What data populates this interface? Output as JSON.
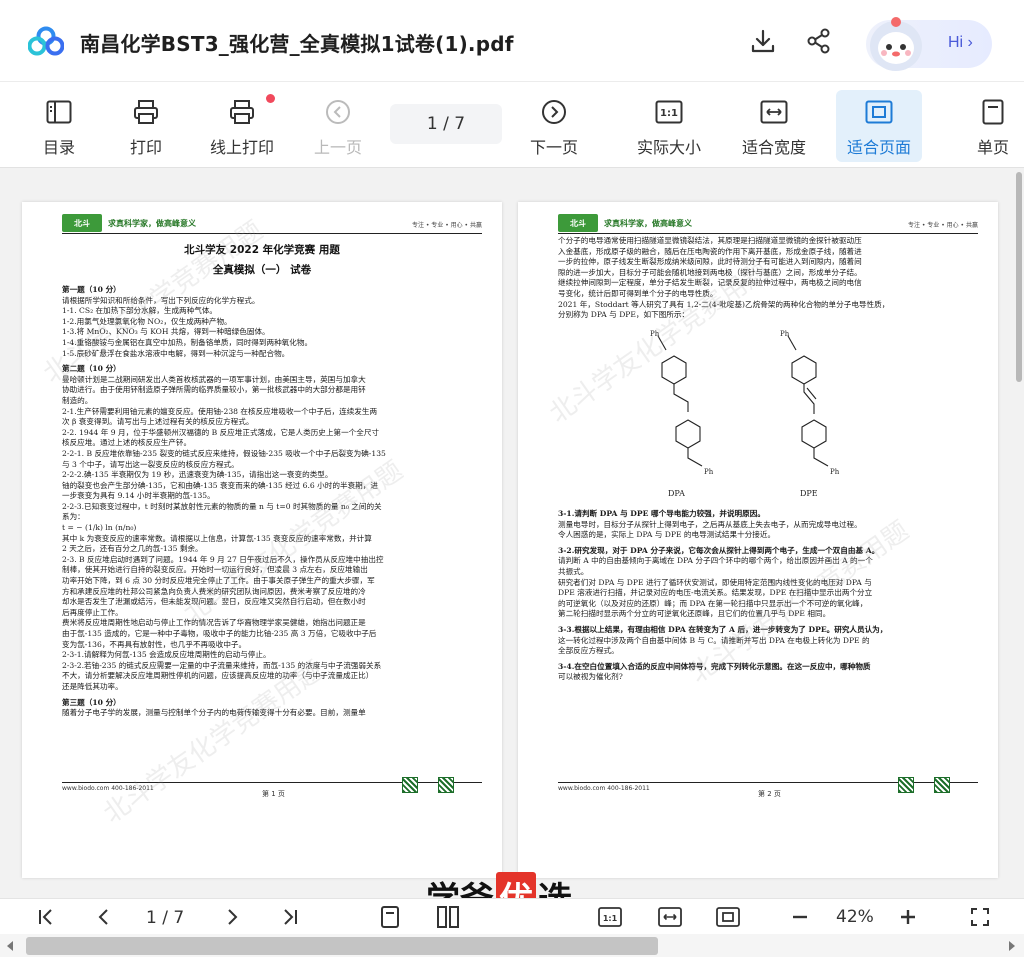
{
  "window": {
    "title": "南昌化学BST3_强化营_全真模拟1试卷(1).pdf",
    "hi_label": "Hi"
  },
  "toolbar": {
    "toc": "目录",
    "print": "打印",
    "online_print": "线上打印",
    "prev_page": "上一页",
    "page_indicator": "1  / 7",
    "next_page": "下一页",
    "actual_size": "实际大小",
    "fit_width": "适合宽度",
    "fit_page": "适合页面",
    "single_page": "单页"
  },
  "page1": {
    "slogan": "求真科学家，做高峰意义",
    "motto": "专注 • 专业 • 用心 • 共赢",
    "title": "北斗学友 2022 年化学竞赛  用题",
    "subtitle": "全真模拟（一）  试卷",
    "lines": [
      {
        "t": "第一题（10 分）",
        "b": true
      },
      {
        "t": "请根据所学知识和所给条件，写出下列反应的化学方程式。"
      },
      {
        "t": "1-1. CS₂ 在加热下部分水解，生成两种气体。"
      },
      {
        "t": "1-2.用氯气处理氯氧化物 NO₂，仅生成两种产物。"
      },
      {
        "t": "1-3.将 MnO₂、KNO₃ 与 KOH 共熔，得到一种暗绿色固体。"
      },
      {
        "t": "1-4.重铬酸铵与金属铝在真空中加热，制备铬单质，同时得到两种氧化物。"
      },
      {
        "t": "1-5.辰砂矿悬浮在食盐水溶液中电解，得到一种沉淀与一种配合物。"
      },
      {
        "t": "第二题（10 分）",
        "b": true
      },
      {
        "t": "曼哈顿计划是二战期间研发出人类首枚核武器的一项军事计划，由美国主导，英国与加拿大"
      },
      {
        "t": "协助进行。由于使用钚制造原子弹所需的临界质量较小，第一批核武器中的大部分都是用钚"
      },
      {
        "t": "制造的。"
      },
      {
        "t": "2-1.生产钚需要利用铀元素的嬗变反应。使用铀-238 在核反应堆吸收一个中子后，连续发生两"
      },
      {
        "t": "次 β 衰变得到。请写出与上述过程有关的核反应方程式。"
      },
      {
        "t": "2-2. 1944 年 9 月，位于华盛顿州汉福德的 B 反应堆正式落成，它是人类历史上第一个全尺寸"
      },
      {
        "t": "核反应堆。通过上述的核反应生产钚。"
      },
      {
        "t": "2-2-1. B 反应堆依靠铀-235 裂变的链式反应来维持，假设铀-235 吸收一个中子后裂变为碘-135"
      },
      {
        "t": "与 3 个中子，请写出这一裂变反应的核反应方程式。"
      },
      {
        "t": "2-2-2.碘-135 半衰期仅为 19 秒，迅速衰变为碘-135，请指出这一衰变的类型。"
      },
      {
        "t": "铀的裂变也会产生部分碘-135，它和由碘-135 衰变而来的碘-135 经过 6.6 小时的半衰期，进"
      },
      {
        "t": "一步衰变为具有 9.14 小时半衰期的氙-135。"
      },
      {
        "t": "2-2-3.已知衰变过程中，t 时刻时某放射性元素的物质的量 n 与 t=0 时其物质的量 n₀ 之间的关"
      },
      {
        "t": "系为："
      },
      {
        "t": "                        t = − (1/k) ln (n/n₀)"
      },
      {
        "t": "其中 k 为衰变反应的速率常数。请根据以上信息，计算氙-135 衰变反应的速率常数，并计算"
      },
      {
        "t": "2 天之后，还有百分之几的氙-135 剩余。"
      },
      {
        "t": "2-3. B 反应堆启动时遇到了问题。1944 年 9 月 27 日午夜过后不久，操作员从反应堆中抽出控"
      },
      {
        "t": "制棒，使其开始进行自持的裂变反应。开始时一切运行良好，但凌晨 3 点左右，反应堆输出"
      },
      {
        "t": "功率开始下降，到 6 点 30 分时反应堆完全停止了工作。由于事关原子弹生产的重大步骤，军"
      },
      {
        "t": "方和承建反应堆的杜邦公司紧急向负责人费米的研究团队询问原因，费米考察了反应堆的冷"
      },
      {
        "t": "却水是否发生了泄漏或结污，但未能发现问题。翌日，反应堆又突然自行启动，但在数小时"
      },
      {
        "t": "后再度停止工作。"
      },
      {
        "t": "费米将反应堆周期性地启动与停止工作的情况告诉了华裔物理学家吴健雄，她指出问题正是"
      },
      {
        "t": "由于氙-135 造成的，它是一种中子毒物，吸收中子的能力比铀-235 高 3 万倍，它吸收中子后"
      },
      {
        "t": "变为氙-136，不再具有放射性，也几乎不再吸收中子。"
      },
      {
        "t": "2-3-1.请解释为何氙-135 会造成反应堆周期性的启动与停止。"
      },
      {
        "t": "2-3-2.若铀-235 的链式反应需要一定量的中子流量来维持，而氙-135 的浓度与中子流强弱关系"
      },
      {
        "t": "不大，请分析要解决反应堆周期性停机的问题，应该提高反应堆的功率（与中子流量成正比）"
      },
      {
        "t": "还是降低其功率。"
      },
      {
        "t": "第三题（10 分）",
        "b": true
      },
      {
        "t": "随着分子电子学的发展，测量与控制单个分子内的电荷传输变得十分有必要。目前，测量单"
      }
    ],
    "footer_url": "www.biodo.com   400-186-2011",
    "footer_page": "第 1 页",
    "watermark": "北斗学友化学竞赛用题"
  },
  "page2": {
    "slogan": "求真科学家，做高峰意义",
    "motto": "专注 • 专业 • 用心 • 共赢",
    "lines_top": [
      {
        "t": "个分子的电导通常使用扫描隧道显微镜裂结法，其原理是扫描隧道显微镜的金探针被驱动压"
      },
      {
        "t": "入金基底，形成原子级的融合，随后在压电陶瓷的作用下离开基底，形成金原子线，随着进"
      },
      {
        "t": "一步的拉伸，原子线发生断裂形成纳米级间隙，此时待测分子有可能进入到间隙内，随着间"
      },
      {
        "t": "隙的进一步加大，目标分子可能会随机地接到两电极（探针与基底）之间，形成单分子结。"
      },
      {
        "t": "继续拉伸间隙到一定程度，单分子结发生断裂，记录反复的拉伸过程中，两电极之间的电信"
      },
      {
        "t": "号变化，统计后即可得到单个分子的电导性质。"
      },
      {
        "t": "2021 年，Stoddart 等人研究了具有 1,2-二(4-吡啶基)乙烷骨架的两种化合物的单分子电导性质，"
      },
      {
        "t": "分别称为 DPA 与 DPE，如下图所示："
      }
    ],
    "dpa": "DPA",
    "dpe": "DPE",
    "ph": "Ph",
    "lines_bottom": [
      {
        "t": "3-1.请判断 DPA 与 DPE 哪个导电能力较强，并说明原因。",
        "b": true
      },
      {
        "t": "测量电导时，目标分子从探针上得到电子，之后再从基底上失去电子，从而完成导电过程。"
      },
      {
        "t": "令人困惑的是，实际上 DPA 与 DPE 的电导测试结果十分接近。"
      },
      {
        "t": "3-2.研究发现，对于 DPA 分子来说，它每次会从探针上得到两个电子，生成一个双自由基 A。",
        "b": true
      },
      {
        "t": "请判断 A 中的自由基倾向于离域在 DPA 分子四个环中的哪个两个，给出原因并画出 A 的一个"
      },
      {
        "t": "共振式。"
      },
      {
        "t": "研究者们对 DPA 与 DPE 进行了循环伏安测试，即使用特定范围内线性变化的电压对 DPA 与"
      },
      {
        "t": "DPE 溶液进行扫描，并记录对应的电压-电流关系。结果发现，DPE 在扫描中显示出两个分立"
      },
      {
        "t": "的可逆氧化（以及对应的还原）峰；而 DPA 在第一轮扫描中只显示出一个不可逆的氧化峰，"
      },
      {
        "t": "第二轮扫描时显示两个分立的可逆氧化还原峰，且它们的位置几乎与 DPE 相同。"
      },
      {
        "t": "3-3.根据以上结果，有理由相信 DPA 在转变为了 A 后，进一步转变为了 DPE。研究人员认为，",
        "b": true
      },
      {
        "t": "这一转化过程中涉及两个自由基中间体 B 与 C。请推断并写出 DPA 在电极上转化为 DPE 的"
      },
      {
        "t": "全部反应方程式。"
      },
      {
        "t": "3-4.在空白位置填入合适的反应中间体符号，完成下列转化示意图。在这一反应中，哪种物质",
        "b": true
      },
      {
        "t": "可以被视为催化剂?"
      }
    ],
    "footer_url": "www.biodo.com   400-186-2011",
    "footer_page": "第 2 页",
    "watermark": "北斗学友化学竞赛用题"
  },
  "brand": {
    "pre": "学爸",
    "hl": "优",
    "post": "选"
  },
  "bottombar": {
    "page_indicator": "1  / 7",
    "zoom": "42%"
  },
  "colors": {
    "accent": "#1e7bd6",
    "active_bg": "#e3f0fb",
    "red_dot": "#f1495c",
    "brand_red": "#e4342a"
  }
}
